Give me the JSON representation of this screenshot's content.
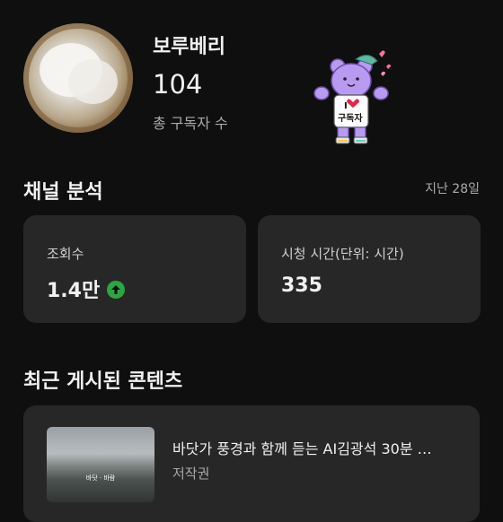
{
  "channel": {
    "name": "보루베리",
    "subscriber_count": "104",
    "subscriber_label": "총 구독자 수",
    "sticker_text_top": "I",
    "sticker_text_bottom": "구독자"
  },
  "analytics": {
    "title": "채널 분석",
    "period": "지난 28일",
    "cards": [
      {
        "label": "조회수",
        "value": "1.4만",
        "trend": "up",
        "trend_color": "#2ba640"
      },
      {
        "label": "시청 시간(단위: 시간)",
        "value": "335"
      }
    ]
  },
  "recent": {
    "title": "최근 게시된 콘텐츠",
    "videos": [
      {
        "title": "바닷가 풍경과 함께 듣는 AI김광석 30분 …",
        "meta": "저작권",
        "thumbnail_caption": "바닷 · 바람"
      }
    ]
  },
  "colors": {
    "background": "#0f0f0f",
    "card": "#272727",
    "text_primary": "#f1f1f1",
    "text_secondary": "#aaaaaa",
    "trend_up": "#2ba640"
  }
}
